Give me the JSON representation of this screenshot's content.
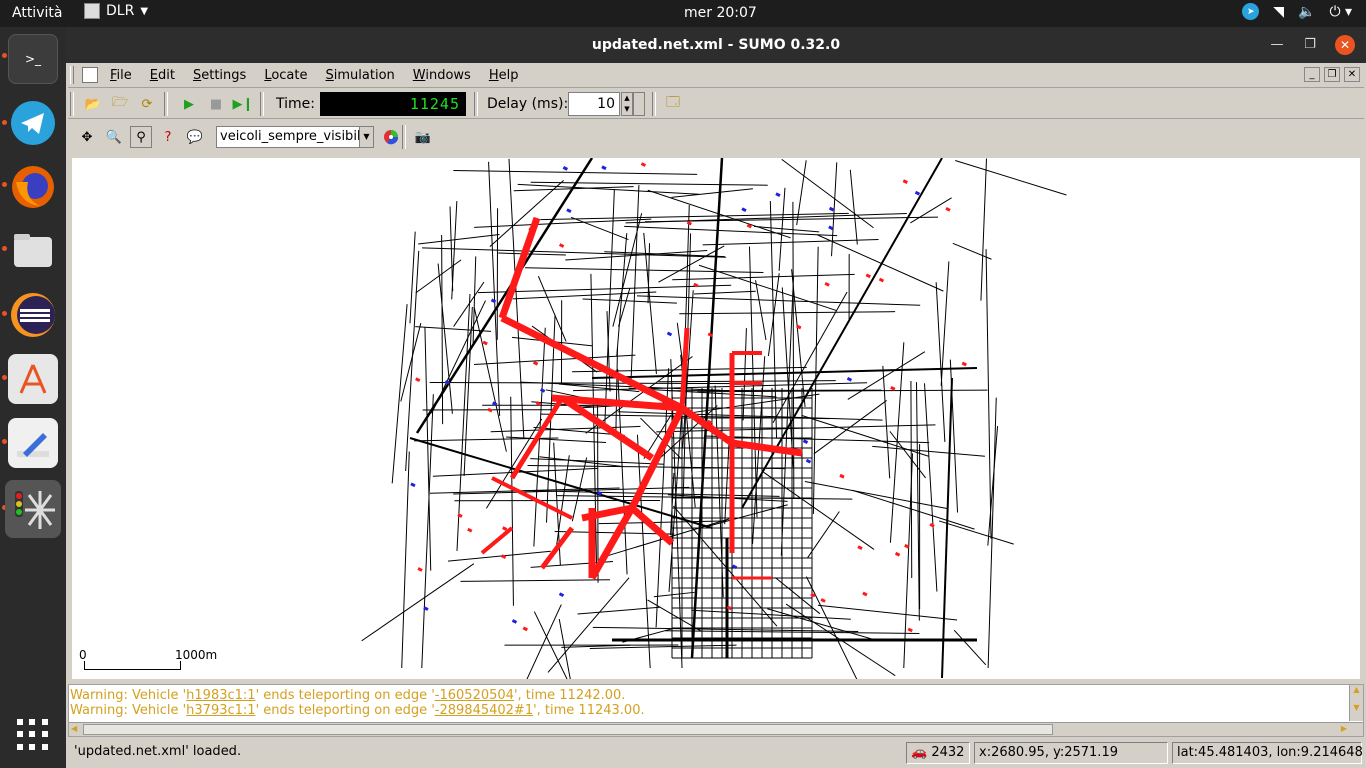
{
  "topbar": {
    "activities": "Attività",
    "app_name": "DLR",
    "clock": "mer 20:07"
  },
  "dock": {
    "items": [
      "Terminal",
      "Telegram",
      "Firefox",
      "Files",
      "Eclipse",
      "Ubuntu Software",
      "Text Editor",
      "SUMO"
    ]
  },
  "window": {
    "title": "updated.net.xml - SUMO 0.32.0"
  },
  "menubar": {
    "items": [
      "File",
      "Edit",
      "Settings",
      "Locate",
      "Simulation",
      "Windows",
      "Help"
    ]
  },
  "toolbar1": {
    "time_label": "Time:",
    "time_value": "11245",
    "delay_label": "Delay (ms):",
    "delay_value": "10"
  },
  "toolbar2": {
    "scheme_selected": "veicoli_sempre_visibili"
  },
  "map": {
    "scale_start": "0",
    "scale_end": "1000m"
  },
  "log": {
    "lines": [
      {
        "prefix": "Warning: Vehicle '",
        "vehicle": "h1983c1:1",
        "mid": "' ends teleporting on edge '",
        "edge": "-160520504",
        "suffix": "', time 11242.00."
      },
      {
        "prefix": "Warning: Vehicle '",
        "vehicle": "h3793c1:1",
        "mid": "' ends teleporting on edge '",
        "edge": "-289845402#1",
        "suffix": "', time 11243.00."
      }
    ]
  },
  "statusbar": {
    "message": "'updated.net.xml' loaded.",
    "vehicle_count": "2432",
    "coords": "x:2680.95, y:2571.19",
    "geo": "lat:45.481403, lon:9.214648"
  },
  "colors": {
    "congestion": "#ff1a1a",
    "warning_text": "#d4a020",
    "lcd_text": "#20e020"
  }
}
